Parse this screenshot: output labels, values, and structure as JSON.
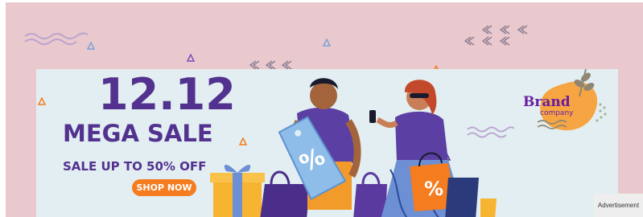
{
  "banner": {
    "headline": "12.12",
    "subheadline": "MEGA SALE",
    "offer": "SALE UP TO 50% OFF",
    "cta_label": "SHOP NOW",
    "brand_name": "Brand",
    "brand_tagline": "company",
    "tag_symbol": "%",
    "bag_symbol": "%"
  },
  "ad_label": "Advertisement",
  "colors": {
    "background": "#e9c9cd",
    "panel": "#e2eef1",
    "primary_purple": "#53328f",
    "cta_orange": "#f57c1f",
    "brand_purple": "#6b1fa0",
    "brand_blob": "#f7a542"
  },
  "icons": [
    "squiggle-icon",
    "triangle-icon",
    "arrow-left-icon",
    "gift-box-icon",
    "shopping-bag-icon",
    "price-tag-icon",
    "phone-icon",
    "leaf-icon"
  ]
}
